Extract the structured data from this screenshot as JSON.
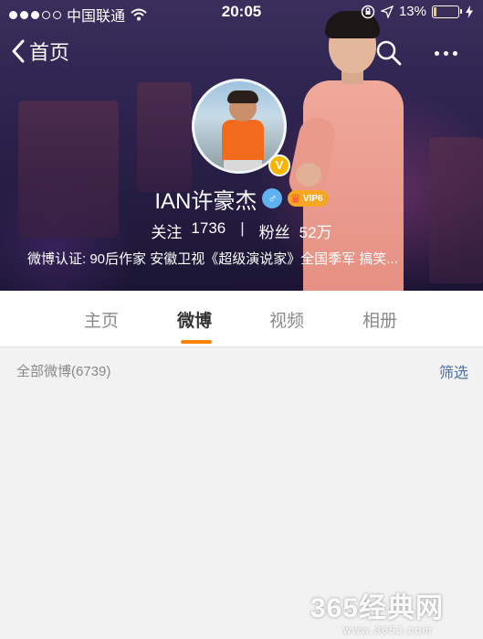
{
  "status_bar": {
    "carrier": "中国联通",
    "time": "20:05",
    "battery": "13%",
    "battery_level": 0.13
  },
  "nav": {
    "back_label": "首页",
    "back_icon": "chevron-left-icon",
    "search_icon": "search-icon",
    "more_icon": "more-dots-icon"
  },
  "profile": {
    "name": "IAN许豪杰",
    "verified_mark": "V",
    "gender_symbol": "♂",
    "vip_label": "VIP6",
    "following_label": "关注",
    "following_count": "1736",
    "separator": "|",
    "followers_label": "粉丝",
    "followers_count": "52万",
    "certification": "微博认证: 90后作家 安徽卫视《超级演说家》全国季军 搞笑..."
  },
  "tabs": [
    {
      "label": "主页"
    },
    {
      "label": "微博"
    },
    {
      "label": "视频"
    },
    {
      "label": "相册"
    }
  ],
  "active_tab": "微博",
  "filter": {
    "count_label": "全部微博(6739)",
    "filter_label": "筛选"
  },
  "watermark": {
    "main": "365经典网",
    "sub": "www.365J.com"
  },
  "colors": {
    "accent": "#ff8200",
    "link": "#4a6fa5",
    "vip": "#f5a623",
    "verified": "#f7b500"
  }
}
